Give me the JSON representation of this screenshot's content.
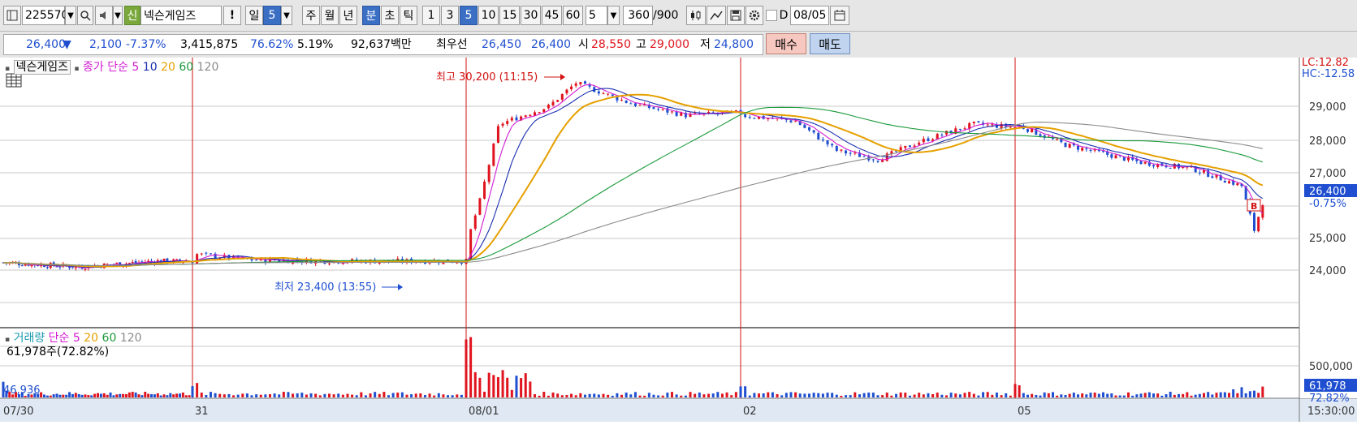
{
  "toolbar": {
    "stock_code": "225570",
    "badge": "신",
    "stock_name": "넥슨게임즈",
    "alert": "!",
    "period_day": "일",
    "period_day_n": "5",
    "period_week": "주",
    "period_month": "월",
    "period_year": "년",
    "period_min": "분",
    "period_sec": "초",
    "period_tick": "틱",
    "intervals": [
      "1",
      "3",
      "5",
      "10",
      "15",
      "30",
      "45",
      "60"
    ],
    "interval_selected": "5",
    "count_value": "5",
    "view_count": "360",
    "view_total": "/900",
    "d_label": "D",
    "date_value": "08/05"
  },
  "info": {
    "price": "26,400",
    "arrow": "▼",
    "change": "2,100",
    "change_pct": "-7.37%",
    "volume": "3,415,875",
    "volume_ratio": "76.62%",
    "turnover": "5.19%",
    "amount": "92,637백만",
    "best_label": "최우선",
    "best_ask": "26,450",
    "best_bid": "26,400",
    "open_label": "시",
    "open": "28,550",
    "high_label": "고",
    "high": "29,000",
    "low_label": "저",
    "low": "24,800",
    "buy": "매수",
    "sell": "매도"
  },
  "price_panel": {
    "name": "넥슨게임즈",
    "ma_label": "종가 단순",
    "ma_periods": [
      "5",
      "10",
      "20",
      "60",
      "120"
    ],
    "high_annotation": "최고 30,200 (11:15)",
    "low_annotation": "최저 23,400 (13:55)",
    "lc": "LC:12.82",
    "hc": "HC:-12.58",
    "y_ticks": [
      "29,000",
      "28,000",
      "27,000",
      "25,000",
      "24,000"
    ],
    "current_price_tag": "26,400",
    "current_pct_tag": "-0.75%",
    "b_marker": "B"
  },
  "volume_panel": {
    "title": "거래량",
    "ma_label": "단순",
    "ma_periods": [
      "5",
      "20",
      "60",
      "120"
    ],
    "current": "61,978주(72.82%)",
    "left_value": "46,936",
    "y_tick": "500,000",
    "current_tag": "61,978",
    "pct_tag": "72.82%"
  },
  "x_axis": {
    "labels": [
      "07/30",
      "31",
      "08/01",
      "02",
      "05"
    ],
    "end_time": "15:30:00"
  },
  "colors": {
    "up": "#e0141e",
    "down": "#1f4fd0",
    "ma5": "#d21bd2",
    "ma10": "#1a2fb0",
    "ma20": "#e6a000",
    "ma60": "#1a9a3a",
    "ma120": "#8a8a8a",
    "separator": "#d21010"
  },
  "chart_data": {
    "type": "candlestick",
    "interval": "5 min",
    "sessions": [
      "07/30",
      "07/31",
      "08/01",
      "08/02",
      "08/05"
    ],
    "session_closes": [
      23800,
      23900,
      29000,
      28400,
      26400
    ],
    "high": 30200,
    "high_time": "11:15",
    "low": 23400,
    "low_time": "13:55",
    "current_price": 26400,
    "ylim": [
      23000,
      30500
    ],
    "y_ticks": [
      24000,
      25000,
      27000,
      28000,
      29000
    ],
    "volume_current": 61978
  }
}
